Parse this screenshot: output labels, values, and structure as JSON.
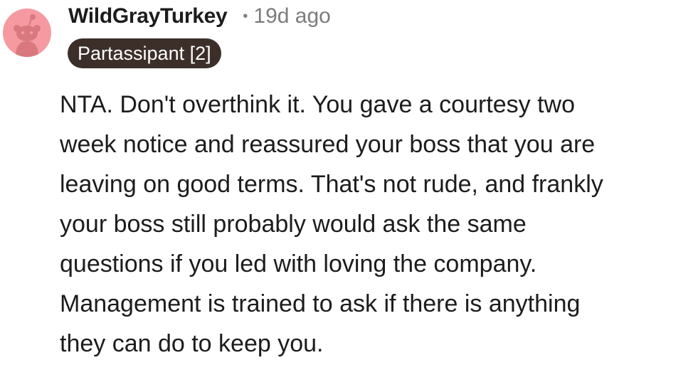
{
  "comment": {
    "author": "WildGrayTurkey",
    "separator": "•",
    "timestamp": "19d ago",
    "flair": "Partassipant [2]",
    "avatar_icon": "snoo-avatar-icon",
    "avatar_color": "#f59aa0",
    "flair_color": "#3c2f2a",
    "body_lines": [
      "NTA. Don't overthink it. You gave a courtesy two",
      "week notice and reassured your boss that you are",
      "leaving on good terms. That's not rude, and frankly",
      "your boss still probably would ask the same",
      "questions if you led with loving the company.",
      "Management is trained to ask if there is anything",
      "they can do to keep you."
    ]
  }
}
